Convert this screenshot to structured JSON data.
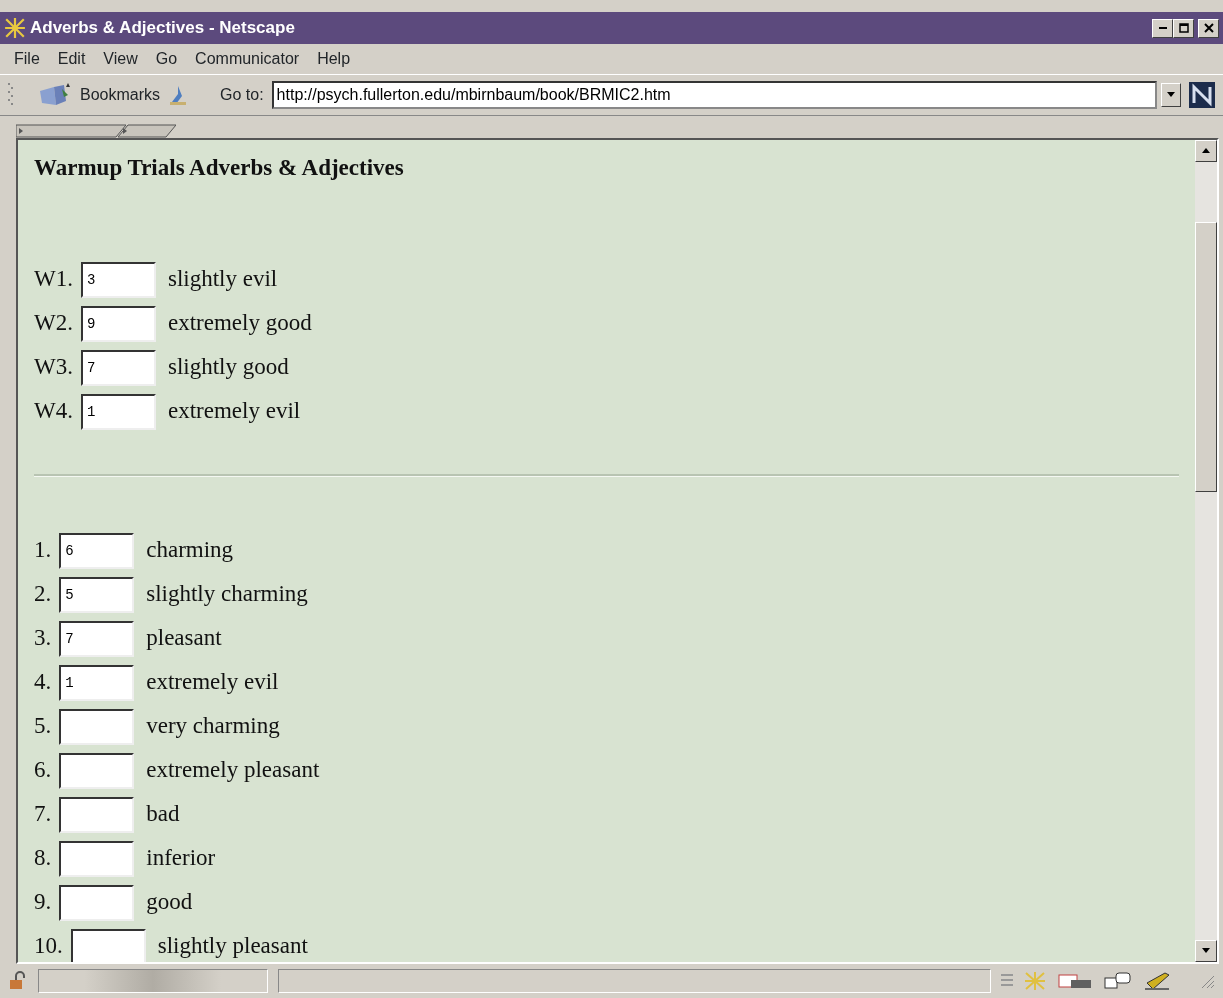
{
  "window": {
    "title": "Adverbs & Adjectives - Netscape"
  },
  "menu": [
    "File",
    "Edit",
    "View",
    "Go",
    "Communicator",
    "Help"
  ],
  "toolbar": {
    "bookmarks": "Bookmarks",
    "goto_label": "Go to:",
    "url": "http://psych.fullerton.edu/mbirnbaum/book/BRMIC2.htm"
  },
  "page": {
    "heading": "Warmup Trials Adverbs & Adjectives",
    "warmup": [
      {
        "label": "W1.",
        "value": "3",
        "text": "slightly evil"
      },
      {
        "label": "W2.",
        "value": "9",
        "text": "extremely good"
      },
      {
        "label": "W3.",
        "value": "7",
        "text": "slightly good"
      },
      {
        "label": "W4.",
        "value": "1",
        "text": "extremely evil"
      }
    ],
    "items": [
      {
        "label": "1.",
        "value": "6",
        "text": "charming"
      },
      {
        "label": "2.",
        "value": "5",
        "text": "slightly charming"
      },
      {
        "label": "3.",
        "value": "7",
        "text": "pleasant"
      },
      {
        "label": "4.",
        "value": "1",
        "text": "extremely evil"
      },
      {
        "label": "5.",
        "text": "very charming"
      },
      {
        "label": "6.",
        "text": "extremely pleasant"
      },
      {
        "label": "7.",
        "text": "bad"
      },
      {
        "label": "8.",
        "text": "inferior"
      },
      {
        "label": "9.",
        "text": "good"
      },
      {
        "label": "10.",
        "text": "slightly pleasant"
      }
    ]
  }
}
